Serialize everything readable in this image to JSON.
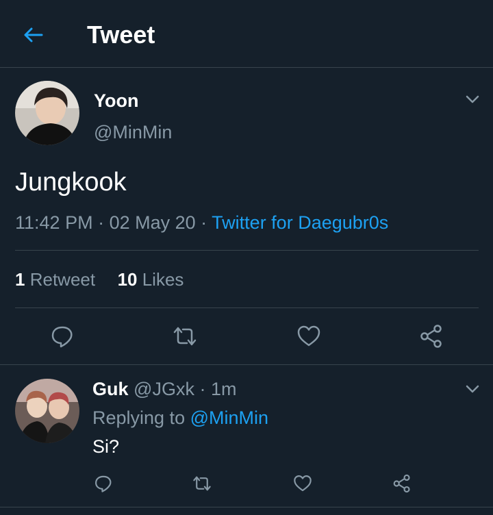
{
  "header": {
    "title": "Tweet",
    "back_icon": "arrow-left-icon"
  },
  "tweet": {
    "author_name": "Yoon",
    "author_handle": "@MinMin",
    "text": "Jungkook",
    "time": "11:42 PM",
    "date": "02 May 20",
    "source": "Twitter for Daegubr0s",
    "retweet_count": "1",
    "retweet_label": "Retweet",
    "likes_count": "10",
    "likes_label": "Likes"
  },
  "reply": {
    "author_name": "Guk",
    "author_handle": "@JGxk",
    "time": "1m",
    "replying_label": "Replying to",
    "replying_handle": "@MinMin",
    "text": "Si?"
  },
  "colors": {
    "background": "#15202b",
    "accent": "#1da1f2",
    "muted": "#8899a6",
    "divider": "#38444d"
  }
}
